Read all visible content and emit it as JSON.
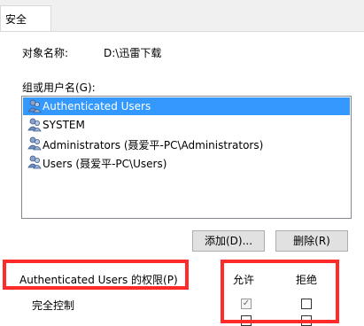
{
  "tabs": [
    {
      "label": "安全"
    }
  ],
  "object": {
    "label": "对象名称:",
    "value": "D:\\迅雷下载"
  },
  "group": {
    "label": "组或用户名(G):"
  },
  "users": [
    {
      "name": "Authenticated Users",
      "selected": true
    },
    {
      "name": "SYSTEM",
      "selected": false
    },
    {
      "name": "Administrators (聂爱平-PC\\Administrators)",
      "selected": false
    },
    {
      "name": "Users (聂爱平-PC\\Users)",
      "selected": false
    }
  ],
  "buttons": {
    "add": "添加(D)...",
    "remove": "删除(R)"
  },
  "permissions": {
    "title": "Authenticated Users 的权限(P)",
    "allow_label": "允许",
    "deny_label": "拒绝",
    "rows": [
      {
        "name": "完全控制",
        "allow": true,
        "deny": false
      },
      {
        "name": "",
        "allow": false,
        "deny": false
      }
    ]
  },
  "colors": {
    "selection": "#3399ff",
    "highlight_border": "#ff2a2a"
  }
}
